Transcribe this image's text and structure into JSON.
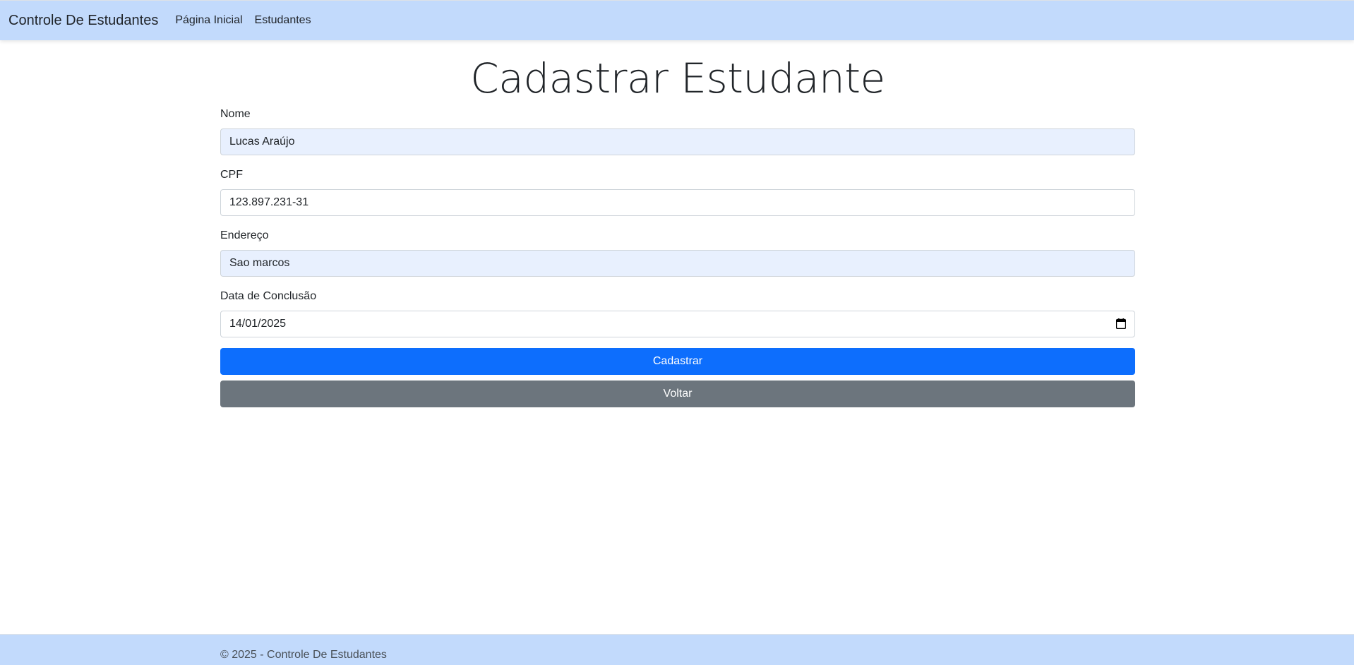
{
  "navbar": {
    "brand": "Controle De Estudantes",
    "links": [
      {
        "label": "Página Inicial"
      },
      {
        "label": "Estudantes"
      }
    ],
    "background_color": "#c2dafc"
  },
  "page": {
    "title": "Cadastrar Estudante"
  },
  "form": {
    "nome": {
      "label": "Nome",
      "value": "Lucas Araújo"
    },
    "cpf": {
      "label": "CPF",
      "value": "123.897.231-31"
    },
    "endereco": {
      "label": "Endereço",
      "value": "Sao marcos"
    },
    "data_conclusao": {
      "label": "Data de Conclusão",
      "value": "14/01/2025",
      "icon": "calendar-icon"
    },
    "submit_label": "Cadastrar",
    "back_label": "Voltar"
  },
  "colors": {
    "primary": "#0d6efd",
    "secondary": "#6c757d",
    "autofill_background": "#e8f0fe"
  },
  "footer": {
    "text": "© 2025 - Controle De Estudantes"
  }
}
